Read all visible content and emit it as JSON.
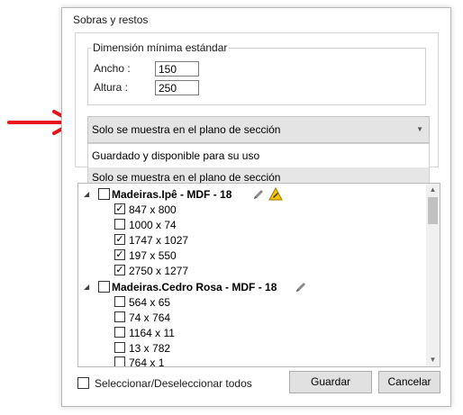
{
  "window": {
    "title": "Sobras y restos"
  },
  "min_dimension": {
    "legend": "Dimensión mínima estándar",
    "width_label": "Ancho :",
    "width_value": "150",
    "height_label": "Altura :",
    "height_value": "250"
  },
  "visibility_combo": {
    "selected": "Solo se muestra en el plano de sección",
    "options": [
      "Guardado y disponible para su uso",
      "Solo se muestra en el plano de sección"
    ]
  },
  "tree": {
    "groups": [
      {
        "label": "Madeiras.Ipê - MDF - 18",
        "checked": false,
        "icons": [
          "pencil-icon",
          "warning-icon"
        ],
        "items": [
          {
            "label": "847 x 800",
            "checked": true
          },
          {
            "label": "1000 x 74",
            "checked": false
          },
          {
            "label": "1747 x 1027",
            "checked": true
          },
          {
            "label": "197 x 550",
            "checked": true
          },
          {
            "label": "2750 x 1277",
            "checked": true
          }
        ]
      },
      {
        "label": "Madeiras.Cedro Rosa - MDF - 18",
        "checked": false,
        "icons": [
          "pencil-icon"
        ],
        "items": [
          {
            "label": "564 x 65",
            "checked": false
          },
          {
            "label": "74 x 764",
            "checked": false
          },
          {
            "label": "1164 x 11",
            "checked": false
          },
          {
            "label": "13 x 782",
            "checked": false
          },
          {
            "label": "764 x 1",
            "checked": false
          }
        ]
      }
    ]
  },
  "footer": {
    "select_all_label": "Seleccionar/Deseleccionar todos",
    "save_label": "Guardar",
    "cancel_label": "Cancelar"
  },
  "colors": {
    "annotation_arrow": "#e8141c",
    "warning": "#f5c400"
  }
}
